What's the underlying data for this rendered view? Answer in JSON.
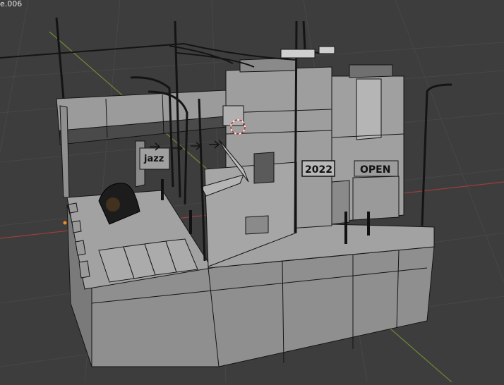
{
  "viewport": {
    "object_label": "e.006",
    "signs": {
      "jazz": "jazz",
      "year": "2022",
      "open": "OPEN"
    }
  },
  "colors": {
    "background": "#3d3d3d",
    "grid": "#474747",
    "x_axis": "#9b3d3d",
    "y_axis": "#6d8a35",
    "mesh_light": "#a2a2a2",
    "mesh_mid": "#8f8f8f",
    "mesh_dark": "#6e6e6e",
    "wire": "#141414"
  }
}
